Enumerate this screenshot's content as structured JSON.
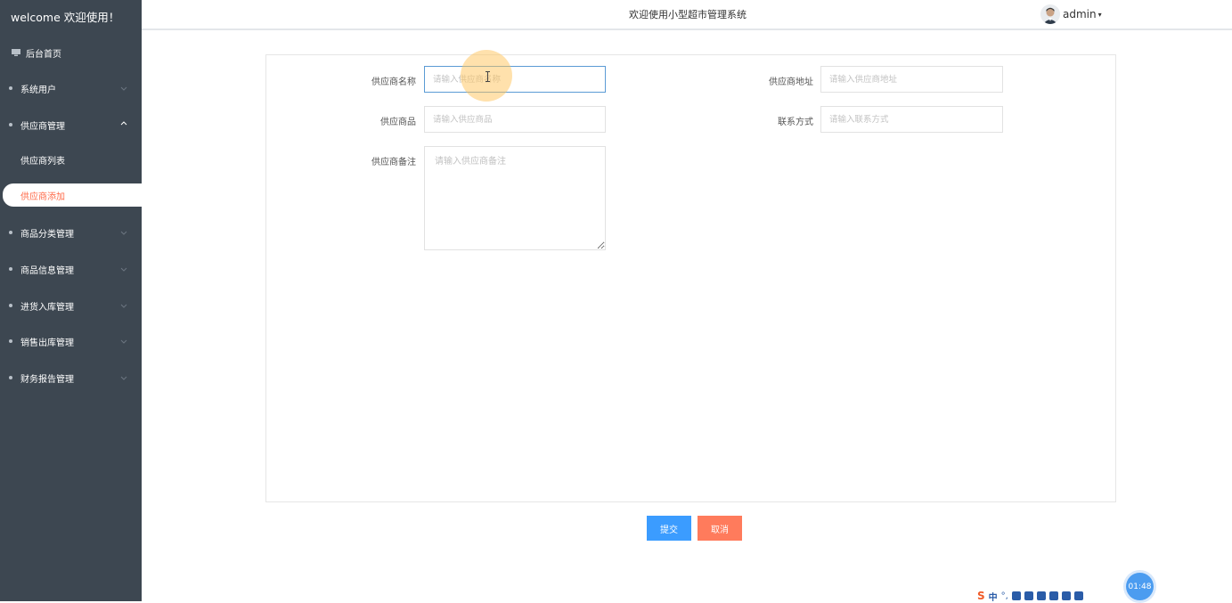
{
  "sidebar": {
    "brand": "welcome 欢迎使用！",
    "home": "后台首页",
    "items": [
      {
        "label": "系统用户"
      },
      {
        "label": "供应商管理"
      },
      {
        "label": "供应商列表"
      },
      {
        "label": "供应商添加"
      },
      {
        "label": "商品分类管理"
      },
      {
        "label": "商品信息管理"
      },
      {
        "label": "进货入库管理"
      },
      {
        "label": "销售出库管理"
      },
      {
        "label": "财务报告管理"
      }
    ]
  },
  "header": {
    "title": "欢迎使用小型超市管理系统",
    "user": "admin",
    "caret": "▾"
  },
  "form": {
    "supplier_name": {
      "label": "供应商名称",
      "placeholder": "请输入供应商名称",
      "value": ""
    },
    "supplier_address": {
      "label": "供应商地址",
      "placeholder": "请输入供应商地址",
      "value": ""
    },
    "supplier_goods": {
      "label": "供应商品",
      "placeholder": "请输入供应商品",
      "value": ""
    },
    "contact": {
      "label": "联系方式",
      "placeholder": "请输入联系方式",
      "value": ""
    },
    "remark": {
      "label": "供应商备注",
      "placeholder": "请输入供应商备注",
      "value": ""
    }
  },
  "actions": {
    "submit": "提交",
    "cancel": "取消"
  },
  "taskbar": {
    "ime_lang": "中",
    "ime_punct": "°,",
    "clock": "01:48"
  },
  "colors": {
    "sidebar_bg": "#3d4751",
    "active_item_text": "#ff6b4a",
    "submit_btn": "#3b9cff",
    "cancel_btn": "#ff7b5c"
  }
}
